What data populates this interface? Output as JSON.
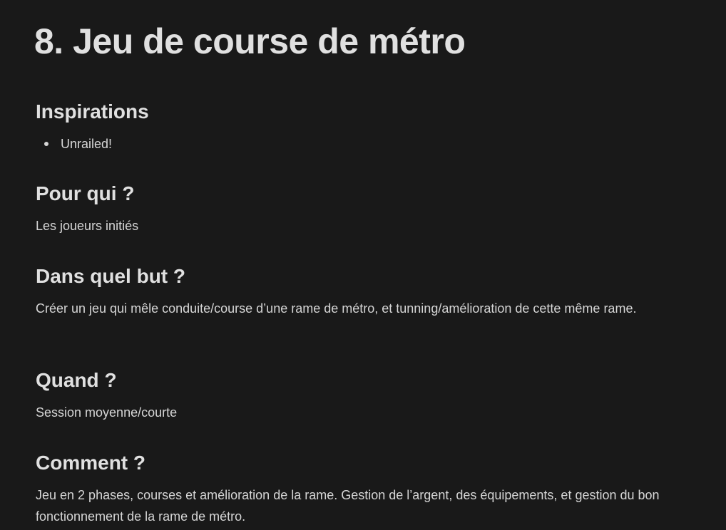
{
  "page": {
    "title": "8. Jeu de course de métro"
  },
  "sections": {
    "inspirations": {
      "heading": "Inspirations",
      "items": [
        "Unrailed!"
      ]
    },
    "pour_qui": {
      "heading": "Pour qui ?",
      "text": "Les joueurs initiés"
    },
    "but": {
      "heading": "Dans quel but ?",
      "text": "Créer un jeu qui mêle conduite/course d’une rame de métro, et tunning/amélioration de cette même rame."
    },
    "quand": {
      "heading": "Quand ?",
      "text": "Session moyenne/courte"
    },
    "comment": {
      "heading": "Comment ?",
      "text": "Jeu en 2 phases, courses et amélioration de la rame. Gestion de l’argent, des équipements, et gestion du bon fonctionnement de la rame de métro."
    }
  },
  "colors": {
    "background": "#191919",
    "text": "#dcdcdc"
  }
}
